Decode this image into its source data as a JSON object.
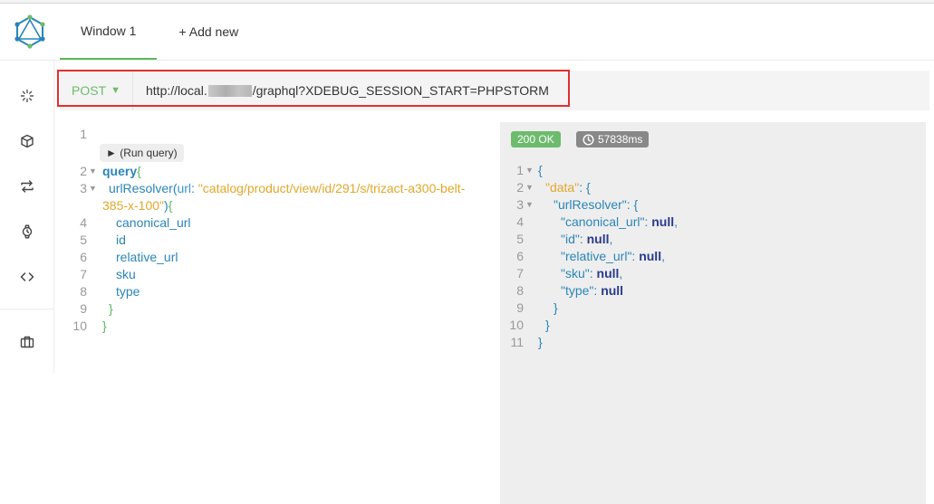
{
  "tabs": [
    {
      "label": "Window 1",
      "active": true
    },
    {
      "label": "+ Add new",
      "active": false
    }
  ],
  "sidebar": {
    "icons": [
      "loading-spinner-icon",
      "cube-icon",
      "transfer-arrows-icon",
      "watch-icon",
      "code-icon",
      "briefcase-icon"
    ]
  },
  "request": {
    "method": "POST",
    "method_caret": "▼",
    "url_prefix": "http://local.",
    "url_suffix": "/graphql?XDEBUG_SESSION_START=PHPSTORM"
  },
  "query": {
    "run_query_label": "► (Run query)",
    "line_numbers": [
      "1",
      "2",
      "3",
      "",
      "4",
      "5",
      "6",
      "7",
      "8",
      "9",
      "10"
    ],
    "keyword_query": "query",
    "func_name": "urlResolver",
    "arg_name": "url",
    "arg_value_line1": "\"catalog/product/view/id/291/s/trizact-a300-belt-",
    "arg_value_line2": "385-x-100\"",
    "fields": [
      "canonical_url",
      "id",
      "relative_url",
      "sku",
      "type"
    ]
  },
  "response": {
    "status": "200 OK",
    "time": "57838ms",
    "line_numbers": [
      "1",
      "2",
      "3",
      "4",
      "5",
      "6",
      "7",
      "8",
      "9",
      "10",
      "11"
    ],
    "data_key": "\"data\"",
    "resolver_key": "\"urlResolver\"",
    "fields": [
      {
        "key": "\"canonical_url\"",
        "value": "null",
        "comma": ","
      },
      {
        "key": "\"id\"",
        "value": "null",
        "comma": ","
      },
      {
        "key": "\"relative_url\"",
        "value": "null",
        "comma": ","
      },
      {
        "key": "\"sku\"",
        "value": "null",
        "comma": ","
      },
      {
        "key": "\"type\"",
        "value": "null",
        "comma": ""
      }
    ]
  },
  "colors": {
    "accent_green": "#5cb85c",
    "highlight_red": "#e03030",
    "keyword_blue": "#2a85b8",
    "string_orange": "#e0a82a"
  }
}
